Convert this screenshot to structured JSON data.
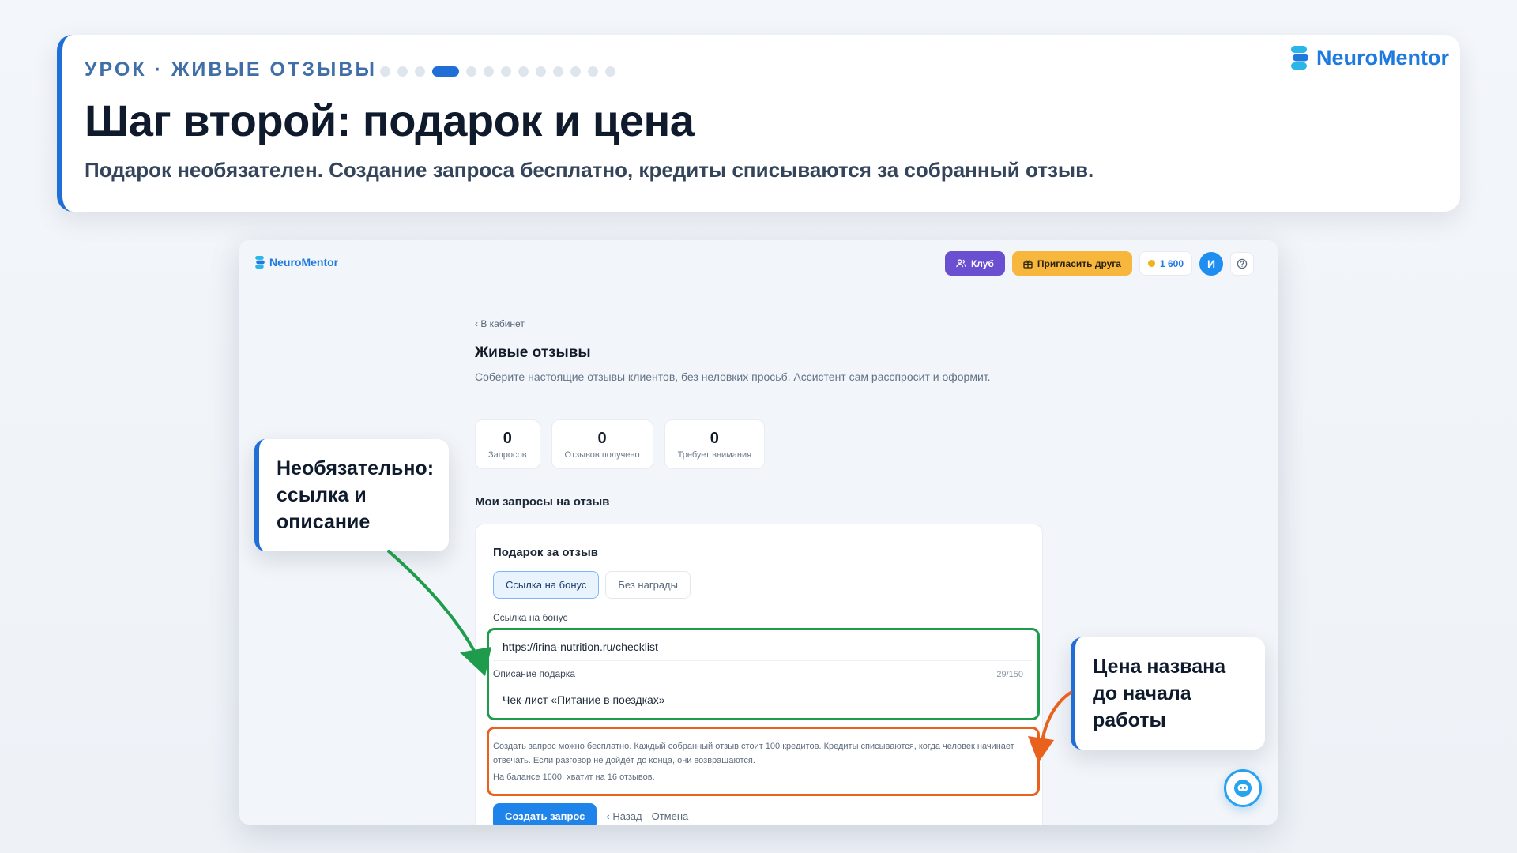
{
  "lesson": {
    "kicker": "УРОК · ЖИВЫЕ ОТЗЫВЫ",
    "title": "Шаг второй: подарок и цена",
    "subtitle": "Подарок необязателен. Создание запроса бесплатно, кредиты списываются за собранный отзыв.",
    "progress": {
      "total_steps": 13,
      "current_step": 4
    },
    "brand": "NeuroMentor"
  },
  "app": {
    "brand": "NeuroMentor",
    "header": {
      "club_label": "Клуб",
      "invite_label": "Пригласить друга",
      "balance": "1 600",
      "avatar_initial": "И"
    },
    "back_link": "‹ В кабинет",
    "title": "Живые отзывы",
    "description": "Соберите настоящие отзывы клиентов, без неловких просьб. Ассистент сам расспросит и оформит.",
    "stats": [
      {
        "value": "0",
        "label": "Запросов"
      },
      {
        "value": "0",
        "label": "Отзывов получено"
      },
      {
        "value": "0",
        "label": "Требует внимания"
      }
    ],
    "section_title": "Мои запросы на отзыв",
    "form": {
      "heading": "Подарок за отзыв",
      "segments": [
        "Ссылка на бонус",
        "Без награды"
      ],
      "active_segment": 0,
      "bonus_link_label": "Ссылка на бонус",
      "bonus_link_value": "https://irina-nutrition.ru/checklist",
      "gift_label": "Описание подарка",
      "gift_char_count": "29/150",
      "gift_value": "Чек-лист «Питание в поездках»",
      "pricing_text": "Создать запрос можно бесплатно. Каждый собранный отзыв стоит 100 кредитов. Кредиты списываются, когда человек начинает отвечать. Если разговор не дойдёт до конца, они возвращаются.",
      "balance_text": "На балансе 1600, хватит на 16 отзывов.",
      "submit_label": "Создать запрос",
      "back_label": "‹ Назад",
      "cancel_label": "Отмена"
    }
  },
  "callouts": {
    "left": [
      "Необязательно:",
      "ссылка и",
      "описание"
    ],
    "right": [
      "Цена названа",
      "до начала",
      "работы"
    ]
  },
  "colors": {
    "accent": "#1f6fd6",
    "brand": "#1f7ae0",
    "highlight_green": "#1f9b4c",
    "highlight_orange": "#e8621e",
    "club": "#6b4fd1",
    "invite": "#f6b73c"
  }
}
